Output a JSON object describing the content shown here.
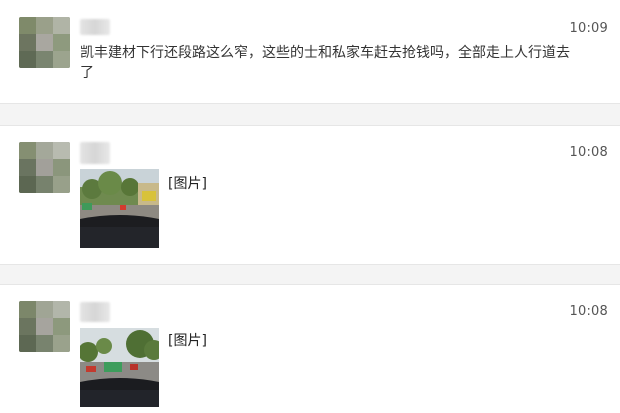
{
  "feed": {
    "messages": [
      {
        "time": "10:09",
        "text": "凯丰建材下行还段路这么窄，这些的士和私家车赶去抢钱吗，全部走上人行道去了"
      },
      {
        "time": "10:08",
        "image_label": "[图片]"
      },
      {
        "time": "10:08",
        "image_label": "[图片]"
      }
    ]
  }
}
